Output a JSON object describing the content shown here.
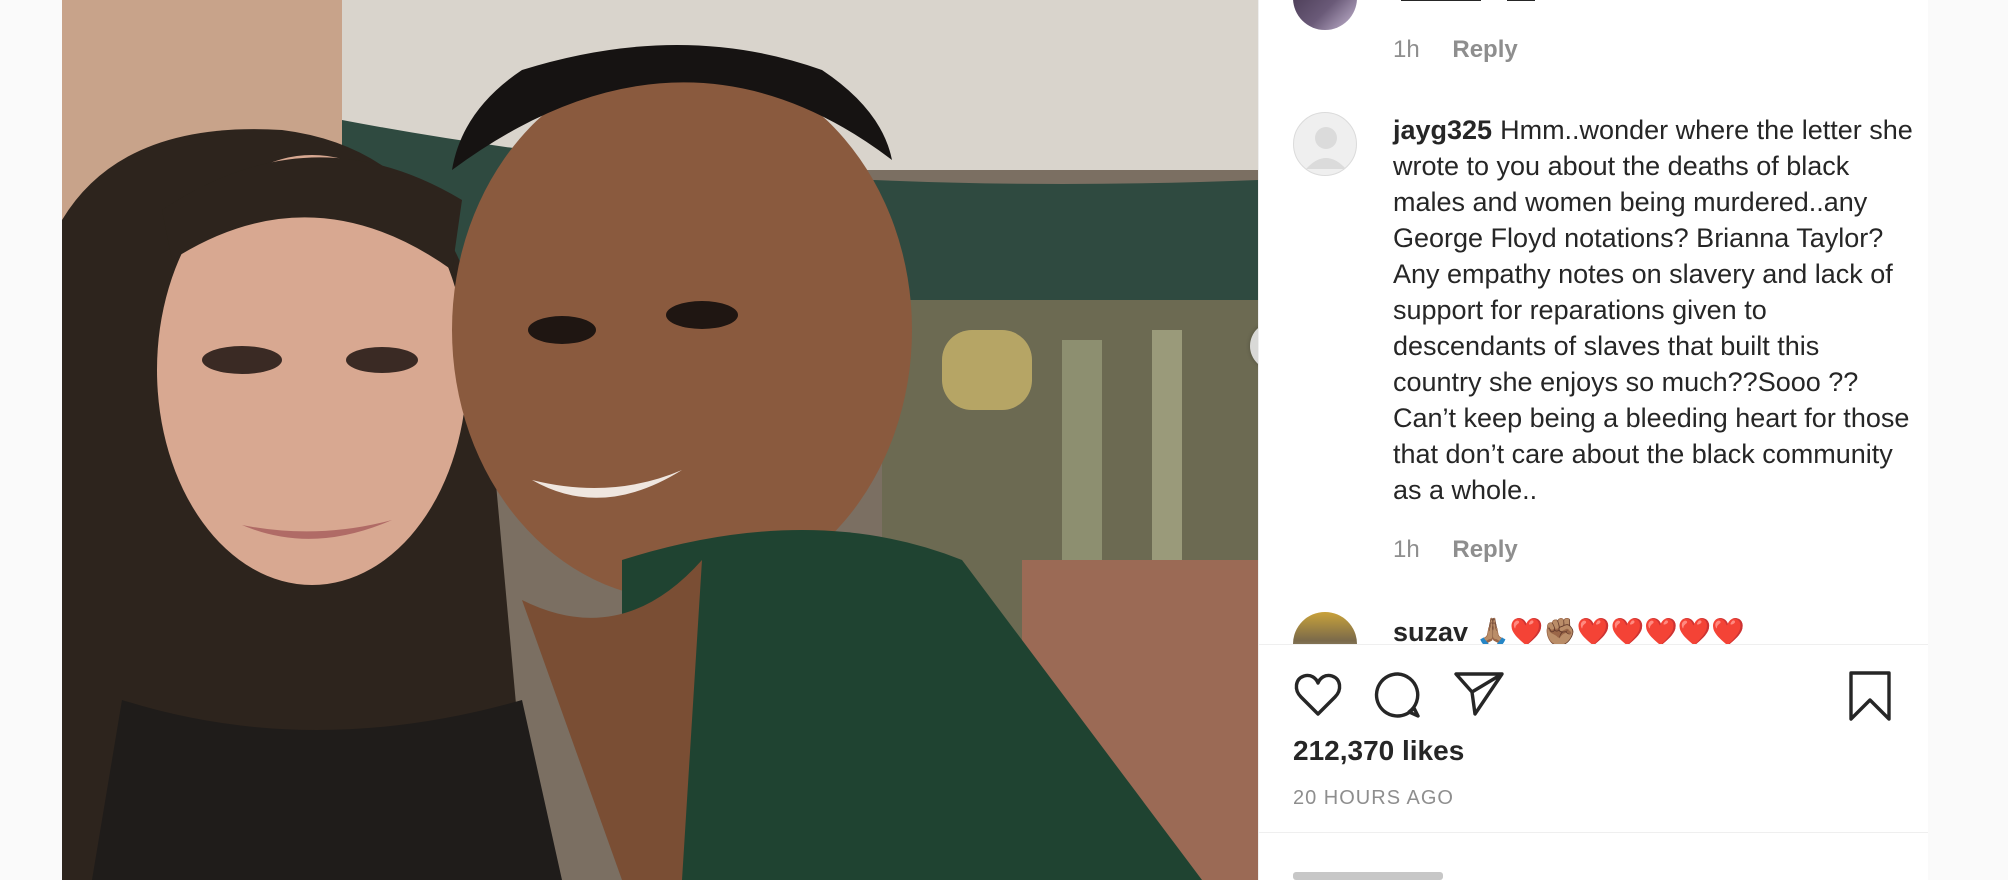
{
  "post": {
    "likes": "212,370 likes",
    "time_ago": "20 HOURS AGO",
    "image_alt": "Selfie of a smiling couple outdoors in front of a building"
  },
  "comments": [
    {
      "username": "",
      "text": "",
      "time": "1h",
      "reply_label": "Reply"
    },
    {
      "username": "jayg325",
      "text": "Hmm..wonder where the letter she wrote to you about the deaths of black males and women being murdered..any George Floyd notations? Brianna Taylor? Any empathy notes on slavery and lack of support for reparations given to descendants of slaves that built this country she enjoys so much??Sooo ?? Can’t keep being a bleeding heart for those that don’t care about the black community as a whole..",
      "time": "1h",
      "reply_label": "Reply"
    },
    {
      "username": "suzav",
      "text": "🙏🏽❤️✊🏽❤️❤️❤️❤️❤️"
    }
  ],
  "icons": {
    "like": "heart-icon",
    "comment": "comment-icon",
    "share": "share-icon",
    "save": "bookmark-icon",
    "next": "chevron-right-icon"
  }
}
